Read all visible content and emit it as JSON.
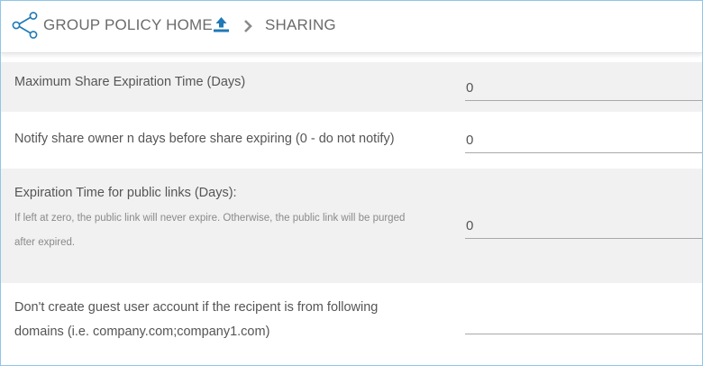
{
  "breadcrumb": {
    "home_label": "GROUP POLICY HOME",
    "current_label": "SHARING",
    "icons": [
      "share-icon",
      "upload-icon",
      "chevron-right-icon"
    ]
  },
  "colors": {
    "brand_blue": "#1f79b5",
    "frame_border": "#8fc6e8",
    "row_gray": "#f1f1f1"
  },
  "settings": [
    {
      "label": "Maximum Share Expiration Time (Days)",
      "value": "0"
    },
    {
      "label": "Notify share owner n days before share expiring (0 - do not notify)",
      "value": "0"
    },
    {
      "label": "Expiration Time for public links (Days):",
      "hint_line1": "If left at zero, the public link will never expire. Otherwise, the public link will be purged",
      "hint_line2": "after expired.",
      "value": "0"
    },
    {
      "label_line1": "Don't create guest user account if the recipent is from following",
      "label_line2": "domains (i.e. company.com;company1.com)",
      "value": ""
    }
  ]
}
